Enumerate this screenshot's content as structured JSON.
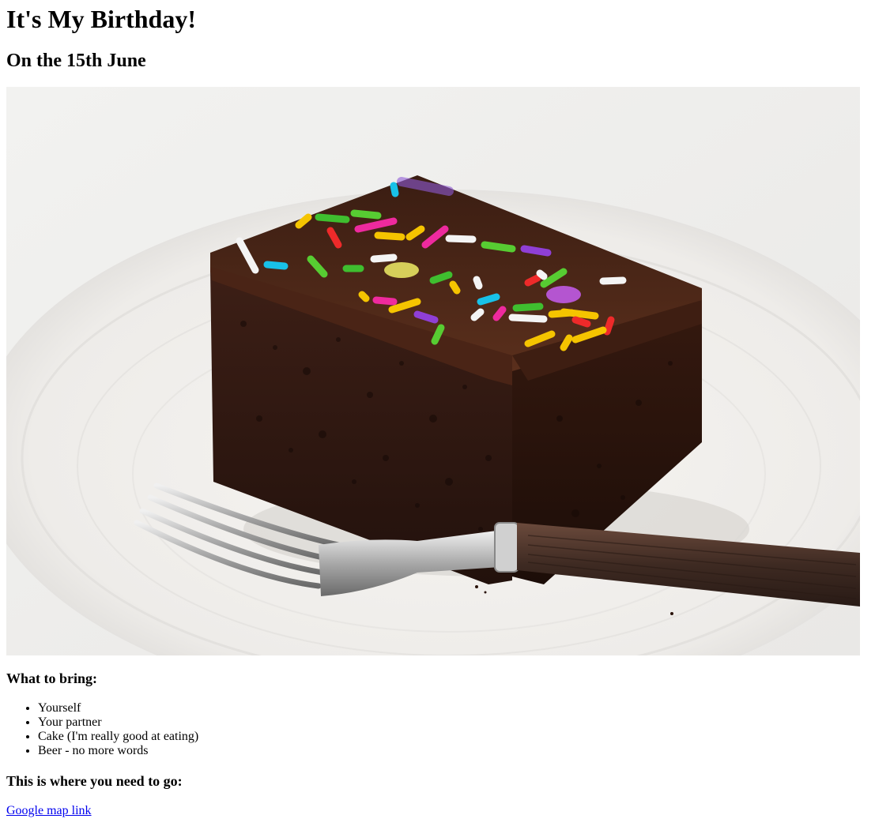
{
  "header": {
    "title": "It's My Birthday!",
    "subtitle": "On the 15th June"
  },
  "image": {
    "name": "chocolate-cake-photo"
  },
  "bring": {
    "heading": "What to bring:",
    "items": [
      "Yourself",
      "Your partner",
      "Cake (I'm really good at eating)",
      "Beer - no more words"
    ]
  },
  "location": {
    "heading": "This is where you need to go:",
    "link_label": "Google map link"
  }
}
